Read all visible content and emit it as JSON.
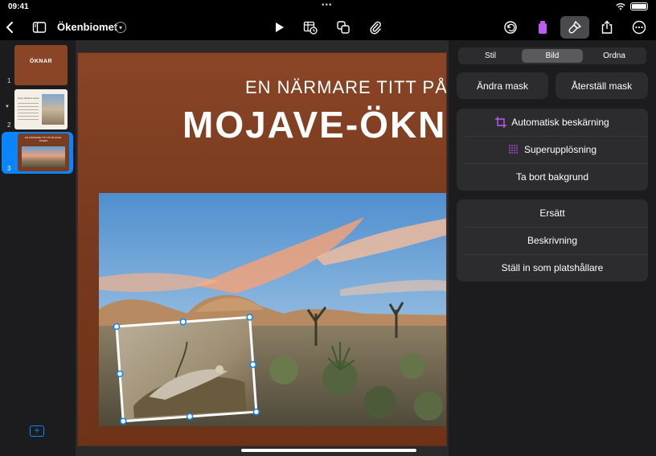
{
  "status_bar": {
    "time": "09:41",
    "center_dots": "•••"
  },
  "toolbar": {
    "document_title": "Ökenbiomet"
  },
  "navigator": {
    "slides": [
      {
        "number": "1",
        "title": "ÖKNAR"
      },
      {
        "number": "2",
        "title": "Hela världens öknar"
      },
      {
        "number": "3",
        "title": "EN NÄRMARE TITT PÅ MOJAVE-ÖKNEN"
      }
    ],
    "selected_slide": "3"
  },
  "slide": {
    "subtitle": "EN NÄRMARE TITT PÅ",
    "title": "MOJAVE-ÖKNEN"
  },
  "inspector": {
    "tabs": [
      {
        "label": "Stil",
        "active": false
      },
      {
        "label": "Bild",
        "active": true
      },
      {
        "label": "Ordna",
        "active": false
      }
    ],
    "mask_buttons": [
      "Ändra mask",
      "Återställ mask"
    ],
    "image_tools": [
      {
        "label": "Automatisk beskärning",
        "icon": "crop-icon"
      },
      {
        "label": "Superupplösning",
        "icon": "grid-dots-icon"
      },
      {
        "label": "Ta bort bakgrund",
        "icon": ""
      }
    ],
    "image_actions": [
      {
        "label": "Ersätt"
      },
      {
        "label": "Beskrivning"
      },
      {
        "label": "Ställ in som platshållare"
      }
    ]
  },
  "colors": {
    "accent": "#0a84ff",
    "slide_background": "#7a3b1f",
    "panel": "#1c1c1e",
    "button": "#2c2c2e",
    "format_accent": "#bf5af2"
  }
}
